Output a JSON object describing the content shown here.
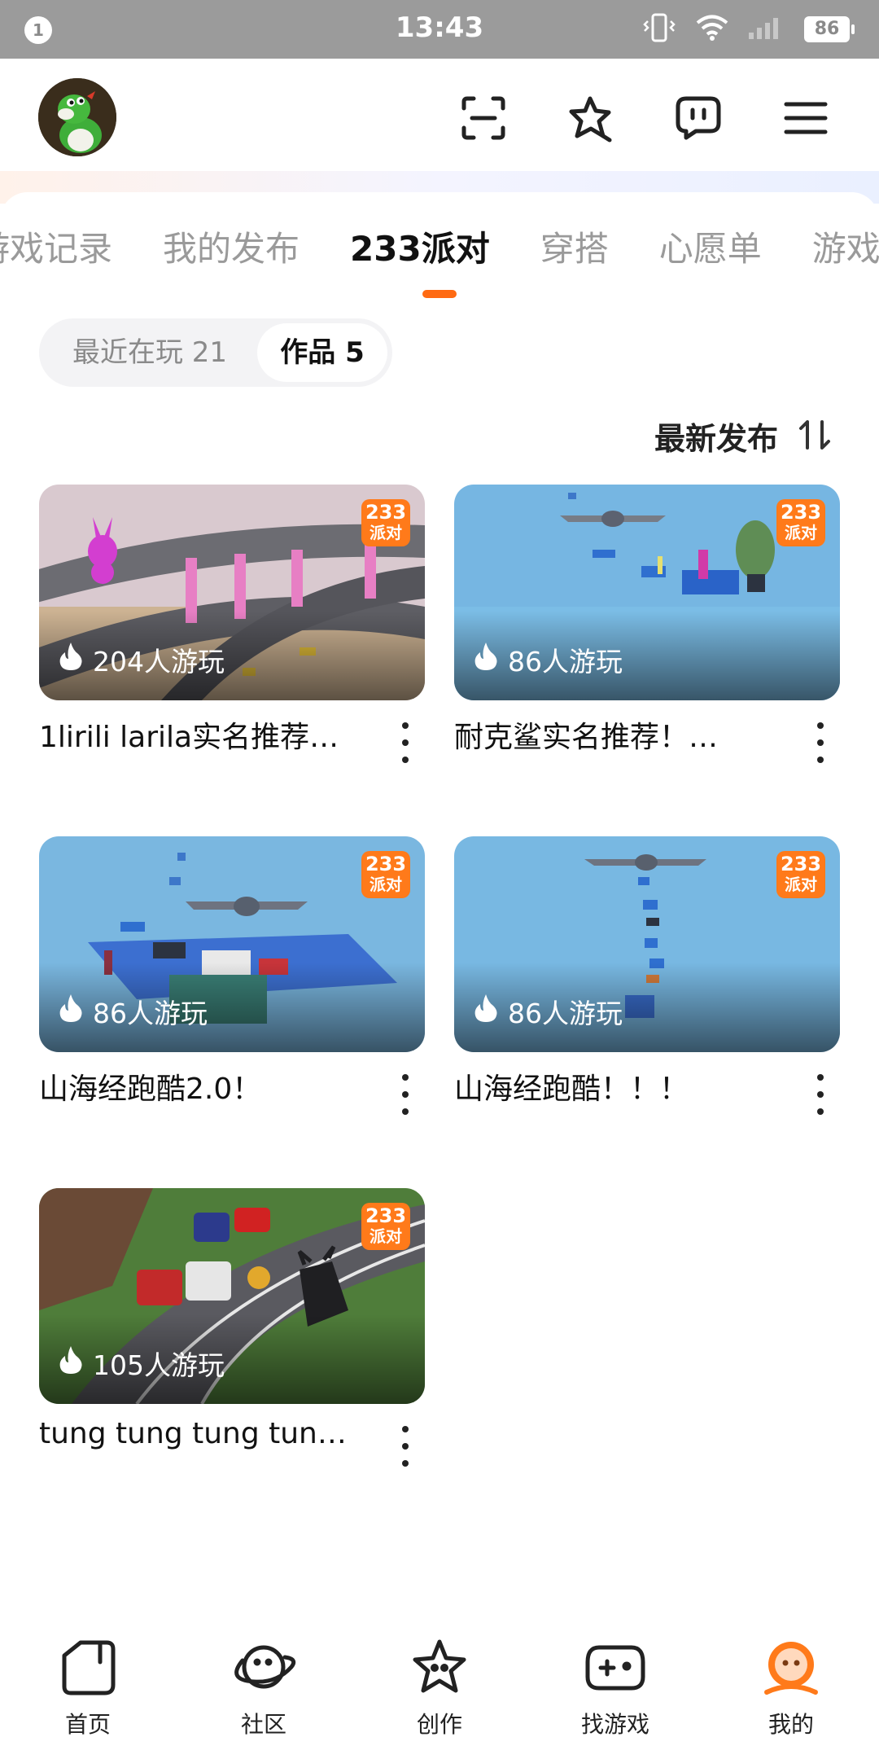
{
  "status_bar": {
    "notification_count": "1",
    "time": "13:43",
    "battery": "86"
  },
  "header": {
    "icons": [
      "scan-icon",
      "favorites-star-icon",
      "messages-icon",
      "menu-icon"
    ]
  },
  "tabs": [
    {
      "label": "游戏记录",
      "active": false
    },
    {
      "label": "我的发布",
      "active": false
    },
    {
      "label": "233派对",
      "active": true
    },
    {
      "label": "穿搭",
      "active": false
    },
    {
      "label": "心愿单",
      "active": false
    },
    {
      "label": "游戏",
      "active": false
    }
  ],
  "segment": {
    "recent_label": "最近在玩 21",
    "works_label": "作品 5"
  },
  "sort": {
    "label": "最新发布"
  },
  "badge": {
    "line1": "233",
    "line2": "派对"
  },
  "cards": [
    {
      "title": "1lirili larila实名推荐…",
      "plays": "204人游玩"
    },
    {
      "title": "耐克鲨实名推荐！…",
      "plays": "86人游玩"
    },
    {
      "title": "山海经跑酷2.0！",
      "plays": "86人游玩"
    },
    {
      "title": "山海经跑酷！！！",
      "plays": "86人游玩"
    },
    {
      "title": "tung tung tung tung…",
      "plays": "105人游玩"
    }
  ],
  "bottom_nav": [
    {
      "label": "首页",
      "active": false
    },
    {
      "label": "社区",
      "active": false
    },
    {
      "label": "创作",
      "active": false
    },
    {
      "label": "找游戏",
      "active": false
    },
    {
      "label": "我的",
      "active": true
    }
  ],
  "colors": {
    "accent": "#ff6a12",
    "badge": "#ff7a1a",
    "status_bar": "#9b9b9b"
  }
}
